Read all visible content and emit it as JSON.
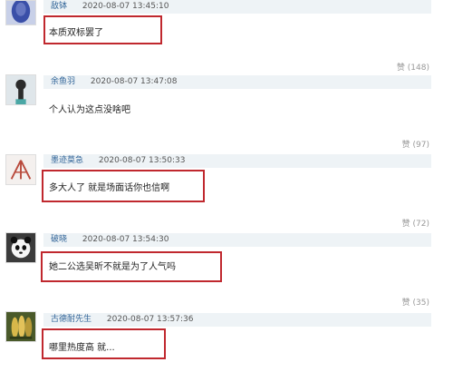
{
  "comments": [
    {
      "username": "敌钵",
      "timestamp": "2020-08-07 13:45:10",
      "text": "本质双标罢了",
      "likes_label": "赞",
      "likes_count": "(148)",
      "avatar": "blue-silhouette-avatar",
      "highlighted": true
    },
    {
      "username": "余鱼羽",
      "timestamp": "2020-08-07 13:47:08",
      "text": "个人认为这点没啥吧",
      "likes_label": "赞",
      "likes_count": "(97)",
      "avatar": "girl-illustration-avatar",
      "highlighted": false
    },
    {
      "username": "墨迹莫急",
      "timestamp": "2020-08-07 13:50:33",
      "text": "多大人了 就是场面话你也信啊",
      "likes_label": "赞",
      "likes_count": "(72)",
      "avatar": "tent-logo-avatar",
      "highlighted": true
    },
    {
      "username": "破晓",
      "timestamp": "2020-08-07 13:54:30",
      "text": "她二公选吴昕不就是为了人气吗",
      "likes_label": "赞",
      "likes_count": "(35)",
      "avatar": "panda-avatar",
      "highlighted": true
    },
    {
      "username": "古德耐先生",
      "timestamp": "2020-08-07 13:57:36",
      "text": "哪里热度高 就...",
      "likes_label": "",
      "likes_count": "",
      "avatar": "corn-avatar",
      "highlighted": true
    }
  ],
  "colors": {
    "highlight_border": "#c0282e",
    "username": "#336699",
    "meta_bar": "#eef3f6"
  }
}
